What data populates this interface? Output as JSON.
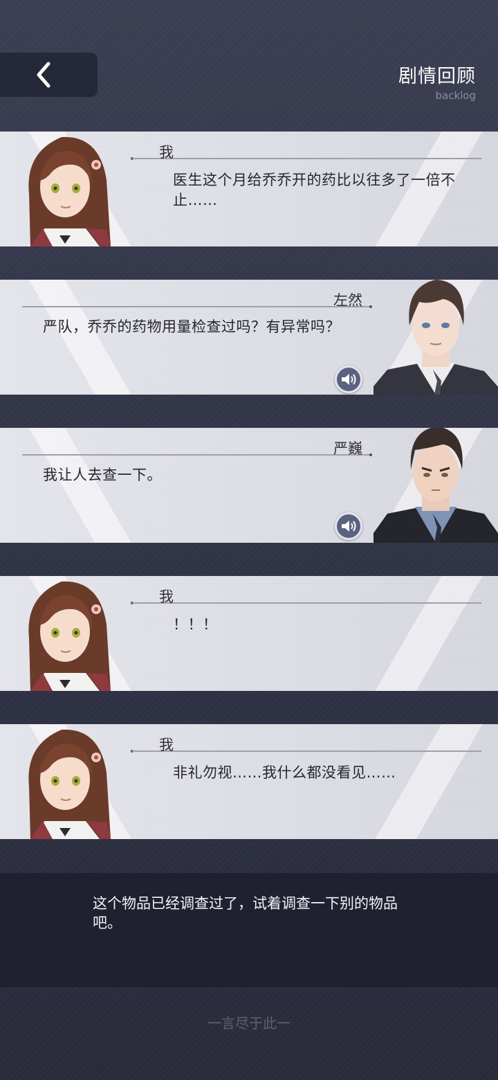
{
  "header": {
    "back_icon": "chevron-left-icon",
    "title": "剧情回顾",
    "subtitle": "backlog"
  },
  "entries": [
    {
      "speaker": "我",
      "text": "医生这个月给乔乔开的药比以往多了一倍不止……",
      "side": "left",
      "portrait": "heroine",
      "voice": false
    },
    {
      "speaker": "左然",
      "text": "严队，乔乔的药物用量检查过吗？有异常吗？",
      "side": "right",
      "portrait": "zuo-ran",
      "voice": true
    },
    {
      "speaker": "严巍",
      "text": "我让人去查一下。",
      "side": "right",
      "portrait": "yan-wei",
      "voice": true
    },
    {
      "speaker": "我",
      "text": "！！！",
      "side": "left",
      "portrait": "heroine",
      "voice": false
    },
    {
      "speaker": "我",
      "text": "非礼勿视……我什么都没看见……",
      "side": "left",
      "portrait": "heroine",
      "voice": false
    }
  ],
  "hint": {
    "text": "这个物品已经调查过了，试着调查一下别的物品吧。"
  },
  "footer": {
    "text": "一言尽于此一"
  },
  "colors": {
    "background": "#34374a",
    "card": "#dcdce4",
    "voice_button": "#5a6281",
    "hint_bar": "#1f2130"
  }
}
